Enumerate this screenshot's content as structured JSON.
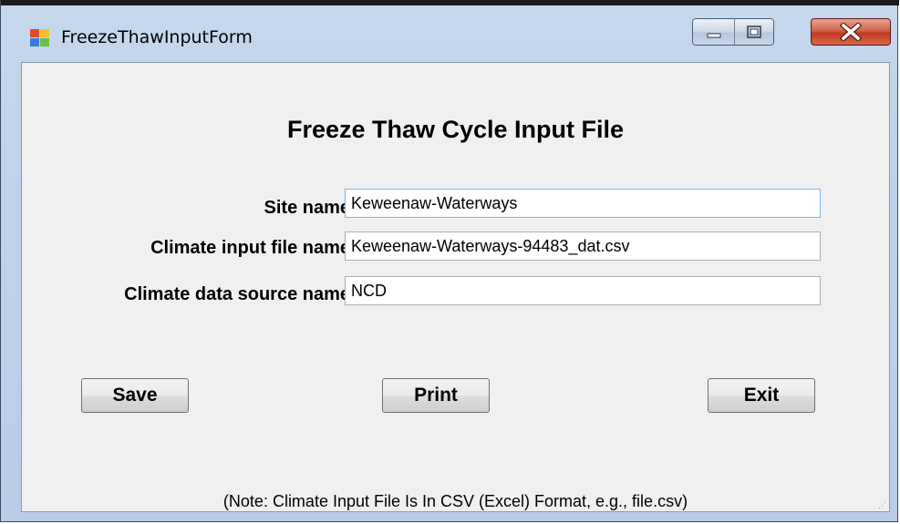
{
  "window": {
    "title": "FreezeThawInputForm",
    "icon": "form-app-icon",
    "controls": {
      "minimize_icon": "minimize-icon",
      "maximize_icon": "maximize-icon",
      "close_icon": "close-icon",
      "close_color": "#c7391f"
    }
  },
  "form": {
    "heading": "Freeze Thaw Cycle Input File",
    "fields": [
      {
        "label": "Site name",
        "value": "Keweenaw-Waterways"
      },
      {
        "label": "Climate input file name",
        "value": "Keweenaw-Waterways-94483_dat.csv"
      },
      {
        "label": "Climate data source name",
        "value": "NCD"
      }
    ],
    "buttons": {
      "save": "Save",
      "print": "Print",
      "exit": "Exit"
    },
    "note": "(Note: Climate Input File Is In CSV (Excel) Format, e.g., file.csv)"
  }
}
